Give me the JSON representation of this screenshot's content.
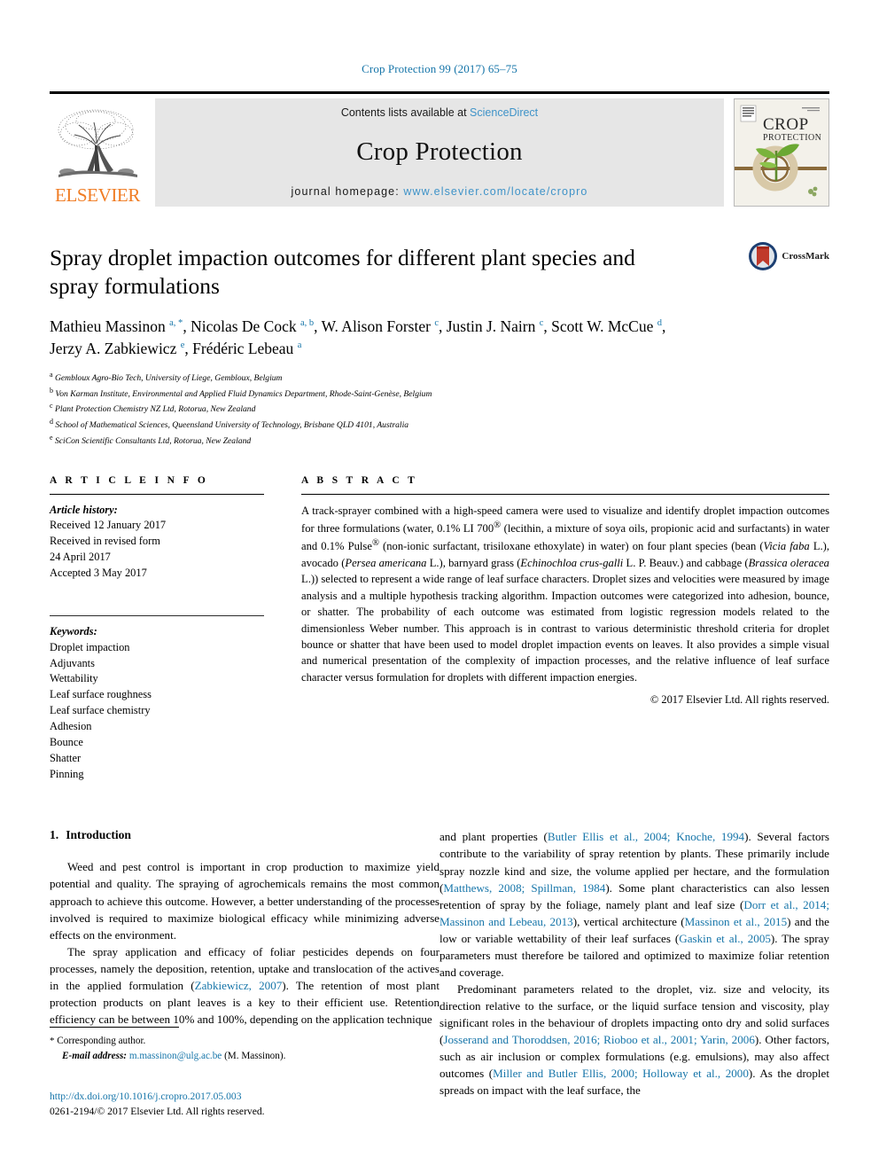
{
  "running_head": "Crop Protection 99 (2017) 65–75",
  "masthead": {
    "publisher_logo_name": "elsevier-tree-logo",
    "publisher_wordmark": "ELSEVIER",
    "contents_prefix": "Contents lists available at ",
    "contents_link": "ScienceDirect",
    "journal_name": "Crop Protection",
    "homepage_prefix": "journal homepage: ",
    "homepage_url": "www.elsevier.com/locate/cropro",
    "cover_title_line1": "CROP",
    "cover_title_line2": "PROTECTION"
  },
  "article": {
    "title": "Spray droplet impaction outcomes for different plant species and spray formulations",
    "crossmark_label": "CrossMark",
    "authors_html": "Mathieu Massinon <sup>a, *</sup>, Nicolas De Cock <sup>a, b</sup>, W. Alison Forster <sup>c</sup>, Justin J. Nairn <sup>c</sup>, Scott W. McCue <sup>d</sup>, Jerzy A. Zabkiewicz <sup>e</sup>, Frédéric Lebeau <sup>a</sup>",
    "affiliations": [
      {
        "mark": "a",
        "text": "Gembloux Agro-Bio Tech, University of Liege, Gembloux, Belgium"
      },
      {
        "mark": "b",
        "text": "Von Karman Institute, Environmental and Applied Fluid Dynamics Department, Rhode-Saint-Genèse, Belgium"
      },
      {
        "mark": "c",
        "text": "Plant Protection Chemistry NZ Ltd, Rotorua, New Zealand"
      },
      {
        "mark": "d",
        "text": "School of Mathematical Sciences, Queensland University of Technology, Brisbane QLD 4101, Australia"
      },
      {
        "mark": "e",
        "text": "SciCon Scientific Consultants Ltd, Rotorua, New Zealand"
      }
    ]
  },
  "article_info": {
    "heading": "A R T I C L E  I N F O",
    "history_label": "Article history:",
    "history_lines": [
      "Received 12 January 2017",
      "Received in revised form",
      "24 April 2017",
      "Accepted 3 May 2017"
    ],
    "keywords_label": "Keywords:",
    "keywords": [
      "Droplet impaction",
      "Adjuvants",
      "Wettability",
      "Leaf surface roughness",
      "Leaf surface chemistry",
      "Adhesion",
      "Bounce",
      "Shatter",
      "Pinning"
    ]
  },
  "abstract": {
    "heading": "A B S T R A C T",
    "html": "A track-sprayer combined with a high-speed camera were used to visualize and identify droplet impaction outcomes for three formulations (water, 0.1% LI 700<sup>&reg;</sup> (lecithin, a mixture of soya oils, propionic acid and surfactants) in water and 0.1% Pulse<sup>&reg;</sup> (non-ionic surfactant, trisiloxane ethoxylate) in water) on four plant species (bean (<i>Vicia faba</i> L.), avocado (<i>Persea americana</i> L.), barnyard grass (<i>Echinochloa crus-galli</i> L. P. Beauv.) and cabbage (<i>Brassica oleracea</i> L.)) selected to represent a wide range of leaf surface characters. Droplet sizes and velocities were measured by image analysis and a multiple hypothesis tracking algorithm. Impaction outcomes were categorized into adhesion, bounce, or shatter. The probability of each outcome was estimated from logistic regression models related to the dimensionless Weber number. This approach is in contrast to various deterministic threshold criteria for droplet bounce or shatter that have been used to model droplet impaction events on leaves. It also provides a simple visual and numerical presentation of the complexity of impaction processes, and the relative influence of leaf surface character versus formulation for droplets with different impaction energies.",
    "copyright": "© 2017 Elsevier Ltd. All rights reserved."
  },
  "introduction": {
    "number": "1.",
    "heading": "Introduction",
    "left_paragraphs_html": [
      "Weed and pest control is important in crop production to maximize yield potential and quality. The spraying of agrochemicals remains the most common approach to achieve this outcome. However, a better understanding of the processes involved is required to maximize biological efficacy while minimizing adverse effects on the environment.",
      "The spray application and efficacy of foliar pesticides depends on four processes, namely the deposition, retention, uptake and translocation of the actives in the applied formulation (<span class=\"ref\">Zabkiewicz, 2007</span>). The retention of most plant protection products on plant leaves is a key to their efficient use. Retention efficiency can be between 10% and 100%, depending on the application technique"
    ],
    "right_paragraphs_html": [
      "and plant properties (<span class=\"ref\">Butler Ellis et al., 2004; Knoche, 1994</span>). Several factors contribute to the variability of spray retention by plants. These primarily include spray nozzle kind and size, the volume applied per hectare, and the formulation (<span class=\"ref\">Matthews, 2008; Spillman, 1984</span>). Some plant characteristics can also lessen retention of spray by the foliage, namely plant and leaf size (<span class=\"ref\">Dorr et al., 2014; Massinon and Lebeau, 2013</span>), vertical architecture (<span class=\"ref\">Massinon et al., 2015</span>) and the low or variable wettability of their leaf surfaces (<span class=\"ref\">Gaskin et al., 2005</span>). The spray parameters must therefore be tailored and optimized to maximize foliar retention and coverage.",
      "Predominant parameters related to the droplet, viz. size and velocity, its direction relative to the surface, or the liquid surface tension and viscosity, play significant roles in the behaviour of droplets impacting onto dry and solid surfaces (<span class=\"ref\">Josserand and Thoroddsen, 2016; Rioboo et al., 2001; Yarin, 2006</span>). Other factors, such as air inclusion or complex formulations (e.g. emulsions), may also affect outcomes (<span class=\"ref\">Miller and Butler Ellis, 2000; Holloway et al., 2000</span>). As the droplet spreads on impact with the leaf surface, the"
    ],
    "right_paragraph_continues_first": true
  },
  "footnote": {
    "star": "*",
    "corresponding": "Corresponding author.",
    "email_label": "E-mail address:",
    "email": "m.massinon@ulg.ac.be",
    "email_owner": "(M. Massinon)."
  },
  "doi_block": {
    "doi_url": "http://dx.doi.org/10.1016/j.cropro.2017.05.003",
    "issn_line": "0261-2194/© 2017 Elsevier Ltd. All rights reserved."
  },
  "colors": {
    "link_blue": "#1675a9",
    "sciencedirect_blue": "#3f93c8",
    "elsevier_orange": "#f07c23",
    "masthead_gray": "#e6e6e6"
  }
}
